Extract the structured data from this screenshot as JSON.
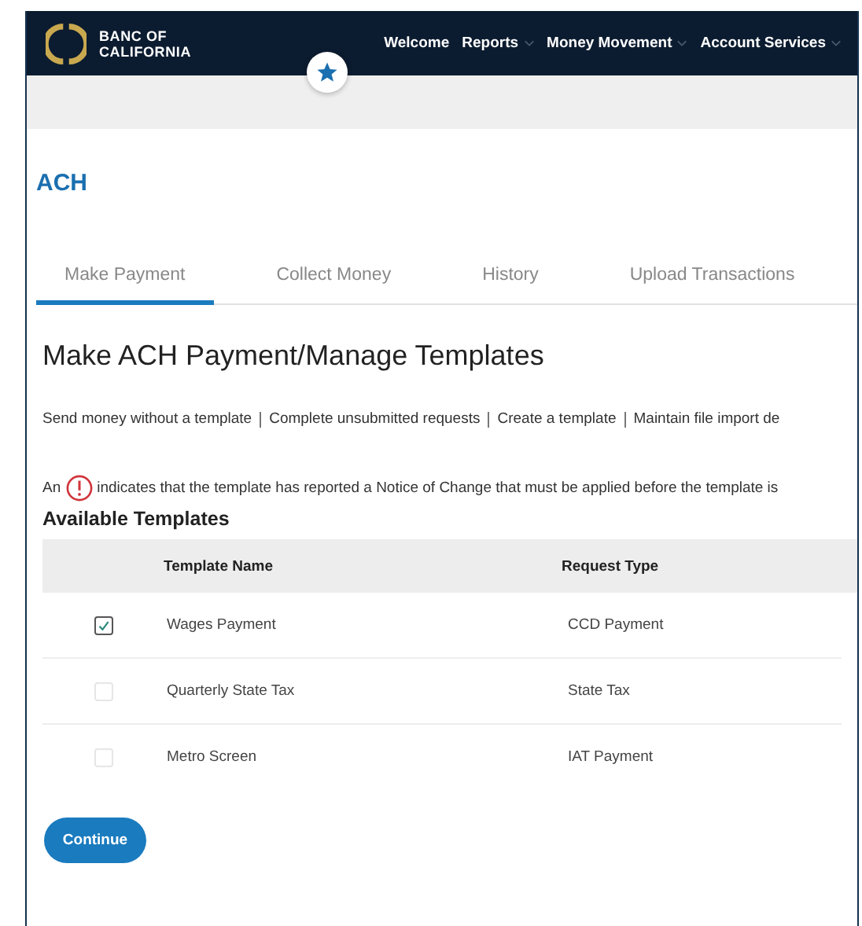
{
  "brand": {
    "line_1": "BANC OF",
    "line_2": "CALIFORNIA"
  },
  "nav": [
    {
      "label": "Welcome",
      "dropdown": false
    },
    {
      "label": "Reports",
      "dropdown": true
    },
    {
      "label": "Money Movement",
      "dropdown": true
    },
    {
      "label": "Account Services",
      "dropdown": true
    }
  ],
  "page_title": "ACH",
  "tabs": [
    {
      "label": "Make Payment",
      "selected": true
    },
    {
      "label": "Collect Money",
      "selected": false
    },
    {
      "label": "History",
      "selected": false
    },
    {
      "label": "Upload Transactions",
      "selected": false
    }
  ],
  "heading": "Make ACH Payment/Manage Templates",
  "links": [
    "Send money without a template",
    "Complete unsubmitted requests",
    "Create a template",
    "Maintain file import de"
  ],
  "notice": {
    "before": "An",
    "after": "indicates that the template has reported a Notice of Change that must be applied before the template is"
  },
  "section_title": "Available Templates",
  "table": {
    "columns": [
      "Template Name",
      "Request Type"
    ],
    "rows": [
      {
        "checked": true,
        "cells": [
          "Wages Payment",
          "CCD Payment"
        ]
      },
      {
        "checked": false,
        "cells": [
          "Quarterly State Tax",
          "State Tax"
        ]
      },
      {
        "checked": false,
        "cells": [
          "Metro Screen",
          "IAT Payment"
        ]
      }
    ]
  },
  "continue_button": "Continue"
}
